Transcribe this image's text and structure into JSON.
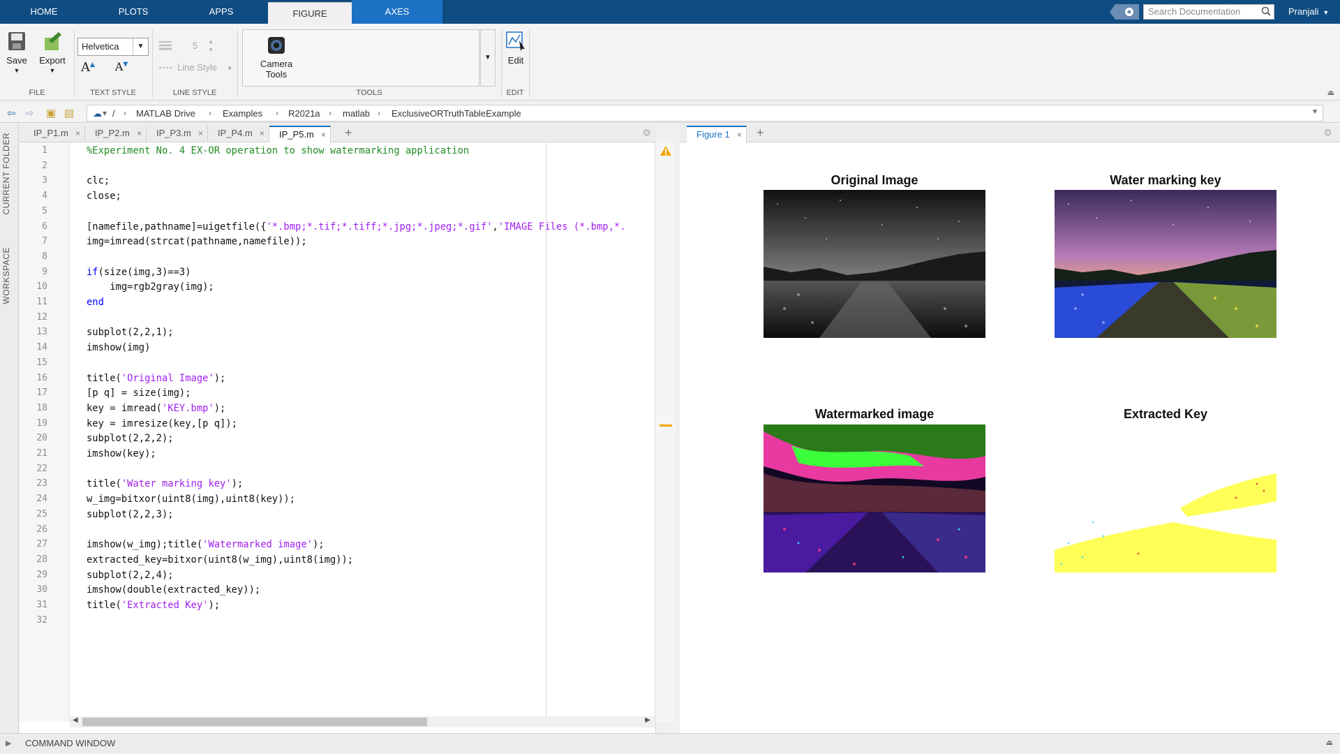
{
  "toptabs": [
    "HOME",
    "PLOTS",
    "APPS",
    "FIGURE",
    "AXES"
  ],
  "search_placeholder": "Search Documentation",
  "user": "Pranjali",
  "ribbon": {
    "save": "Save",
    "export": "Export",
    "font": "Helvetica",
    "line_width": "5",
    "line_style": "Line Style",
    "camera_tools": [
      "Camera",
      "Tools"
    ],
    "edit": "Edit",
    "groups": [
      "FILE",
      "TEXT STYLE",
      "LINE STYLE",
      "TOOLS",
      "EDIT"
    ]
  },
  "path": [
    "/",
    "MATLAB Drive",
    "Examples",
    "R2021a",
    "matlab",
    "ExclusiveORTruthTableExample"
  ],
  "left_panels": [
    "CURRENT FOLDER",
    "WORKSPACE"
  ],
  "editor_tabs": [
    "IP_P1.m",
    "IP_P2.m",
    "IP_P3.m",
    "IP_P4.m",
    "IP_P5.m"
  ],
  "code_lines": [
    "%Experiment No. 4 EX-OR operation to show watermarking application",
    "",
    "clc;",
    "close;",
    "",
    "[namefile,pathname]=uigetfile({'*.bmp;*.tif;*.tiff;*.jpg;*.jpeg;*.gif','IMAGE Files (*.bmp,*.",
    "img=imread(strcat(pathname,namefile));",
    "",
    "if(size(img,3)==3)",
    "    img=rgb2gray(img);",
    "end",
    "",
    "subplot(2,2,1);",
    "imshow(img)",
    "",
    "title('Original Image');",
    "[p q] = size(img);",
    "key = imread('KEY.bmp');",
    "key = imresize(key,[p q]);",
    "subplot(2,2,2);",
    "imshow(key);",
    "",
    "title('Water marking key');",
    "w_img=bitxor(uint8(img),uint8(key));",
    "subplot(2,2,3);",
    "",
    "imshow(w_img);title('Watermarked image');",
    "extracted_key=bitxor(uint8(w_img),uint8(img));",
    "subplot(2,2,4);",
    "imshow(double(extracted_key));",
    "title('Extracted Key');",
    ""
  ],
  "figure_tab": "Figure 1",
  "subplots": [
    "Original Image",
    "Water marking key",
    "Watermarked image",
    "Extracted Key"
  ],
  "command_window": "COMMAND WINDOW",
  "colors": {
    "topbar": "#0f4c81",
    "axes_tab": "#1c71c4",
    "comment": "#228b22",
    "string": "#a020f0",
    "keyword": "#0000ff"
  }
}
